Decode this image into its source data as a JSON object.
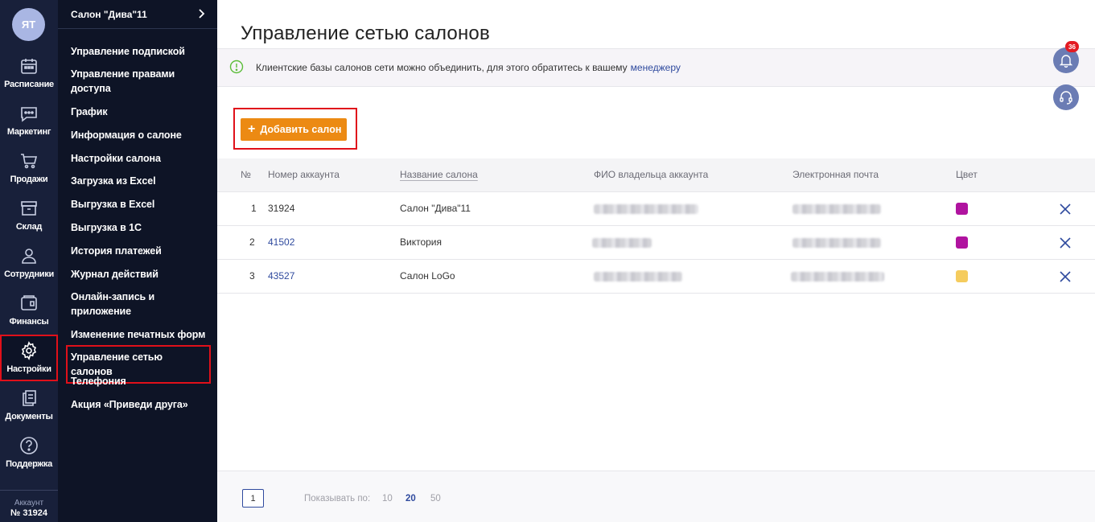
{
  "user": {
    "initials": "ЯТ"
  },
  "rail": {
    "items": [
      {
        "label": "Расписание",
        "icon": "calendar-icon"
      },
      {
        "label": "Маркетинг",
        "icon": "chat-icon"
      },
      {
        "label": "Продажи",
        "icon": "cart-icon"
      },
      {
        "label": "Склад",
        "icon": "box-icon"
      },
      {
        "label": "Сотрудники",
        "icon": "person-icon"
      },
      {
        "label": "Финансы",
        "icon": "wallet-icon"
      },
      {
        "label": "Настройки",
        "icon": "gear-icon"
      },
      {
        "label": "Документы",
        "icon": "documents-icon"
      },
      {
        "label": "Поддержка",
        "icon": "question-icon"
      }
    ],
    "account_label": "Аккаунт",
    "account_number": "№ 31924"
  },
  "submenu": {
    "salon_name": "Салон \"Дива\"11",
    "items": [
      {
        "label": "Управление подпиской"
      },
      {
        "label": "Управление правами доступа"
      },
      {
        "label": "График"
      },
      {
        "label": "Информация о салоне"
      },
      {
        "label": "Настройки салона"
      },
      {
        "label": "Загрузка из Excel"
      },
      {
        "label": "Выгрузка в Excel"
      },
      {
        "label": "Выгрузка в 1С"
      },
      {
        "label": "История платежей"
      },
      {
        "label": "Журнал действий"
      },
      {
        "label": "Онлайн-запись и приложение"
      },
      {
        "label": "Изменение печатных форм"
      },
      {
        "label": "Управление сетью салонов"
      },
      {
        "label": "Телефония"
      },
      {
        "label": "Акция «Приведи друга»"
      }
    ]
  },
  "main": {
    "title": "Управление сетью салонов",
    "info_text": "Клиентские базы салонов сети можно объединить, для этого обратитесь к вашему",
    "info_link": "менеджеру",
    "add_button": "Добавить салон"
  },
  "table": {
    "headers": {
      "num": "№",
      "account": "Номер аккаунта",
      "salon": "Название салона",
      "owner": "ФИО владельца аккаунта",
      "email": "Электронная почта",
      "color": "Цвет"
    },
    "rows": [
      {
        "num": "1",
        "account": "31924",
        "salon": "Салон \"Дива\"11",
        "color": "#b0139f"
      },
      {
        "num": "2",
        "account": "41502",
        "salon": "Виктория",
        "color": "#b0139f"
      },
      {
        "num": "3",
        "account": "43527",
        "salon": "Салон LoGo",
        "color": "#f5cc5e"
      }
    ]
  },
  "pagination": {
    "current_page": "1",
    "per_page_label": "Показывать по:",
    "options": [
      "10",
      "20",
      "50"
    ],
    "selected": "20"
  },
  "notifications": {
    "count": "36"
  },
  "colors": {
    "accent": "#ec8a13",
    "sidebar": "#18203a",
    "submenu": "#0e1426",
    "link": "#2f4a9e",
    "highlight": "#e0101a"
  }
}
